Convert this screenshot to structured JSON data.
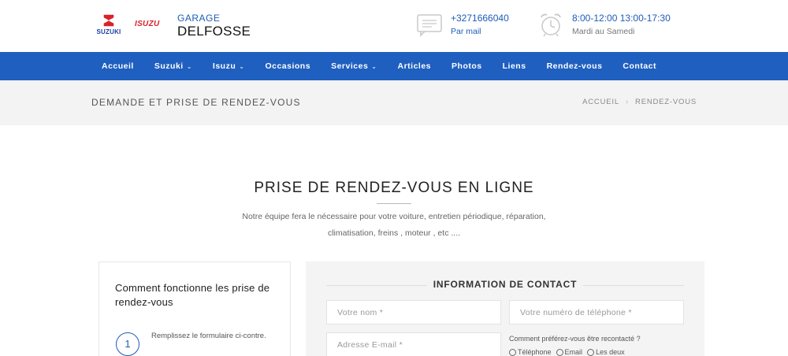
{
  "header": {
    "suzuki_logo_text": "SUZUKI",
    "isuzu_logo_text": "ISUZU",
    "brand_line1": "GARAGE",
    "brand_line2": "DELFOSSE",
    "phone": "+3271666040",
    "mail_label": "Par mail",
    "hours": "8:00-12:00 13:00-17:30",
    "days": "Mardi au Samedi",
    "icons": {
      "mail": "envelope-icon",
      "clock": "alarm-clock-icon"
    }
  },
  "nav": {
    "items": [
      {
        "label": "Accueil",
        "dropdown": false
      },
      {
        "label": "Suzuki",
        "dropdown": true
      },
      {
        "label": "Isuzu",
        "dropdown": true
      },
      {
        "label": "Occasions",
        "dropdown": false
      },
      {
        "label": "Services",
        "dropdown": true
      },
      {
        "label": "Articles",
        "dropdown": false
      },
      {
        "label": "Photos",
        "dropdown": false
      },
      {
        "label": "Liens",
        "dropdown": false
      },
      {
        "label": "Rendez-vous",
        "dropdown": false
      },
      {
        "label": "Contact",
        "dropdown": false
      }
    ]
  },
  "titlebar": {
    "title": "DEMANDE ET PRISE DE RENDEZ-VOUS",
    "breadcrumb": [
      "ACCUEIL",
      "RENDEZ-VOUS"
    ]
  },
  "main": {
    "title": "PRISE DE RENDEZ-VOUS EN LIGNE",
    "intro_line1": "Notre équipe fera le nécessaire pour votre voiture, entretien périodique, réparation,",
    "intro_line2": "climatisation, freins , moteur , etc ...."
  },
  "howto": {
    "heading": "Comment fonctionne les prise de rendez-vous",
    "steps": [
      {
        "number": "1",
        "text": "Remplissez le formulaire ci-contre."
      }
    ]
  },
  "form": {
    "heading": "INFORMATION DE CONTACT",
    "name_placeholder": "Votre nom *",
    "phone_placeholder": "Votre numéro de téléphone *",
    "email_placeholder": "Adresse E-mail *",
    "recontact_label": "Comment préférez-vous être recontacté ?",
    "recontact_options": [
      "Téléphone",
      "Email",
      "Les deux"
    ]
  },
  "colors": {
    "nav_bg": "#1f5fbf",
    "accent": "#1e5bb8",
    "isuzu_red": "#d9222a",
    "suzuki_red": "#d9222a",
    "suzuki_blue": "#1a3fa6",
    "titlebar_bg": "#f3f3f3",
    "form_bg": "#f4f4f4"
  }
}
